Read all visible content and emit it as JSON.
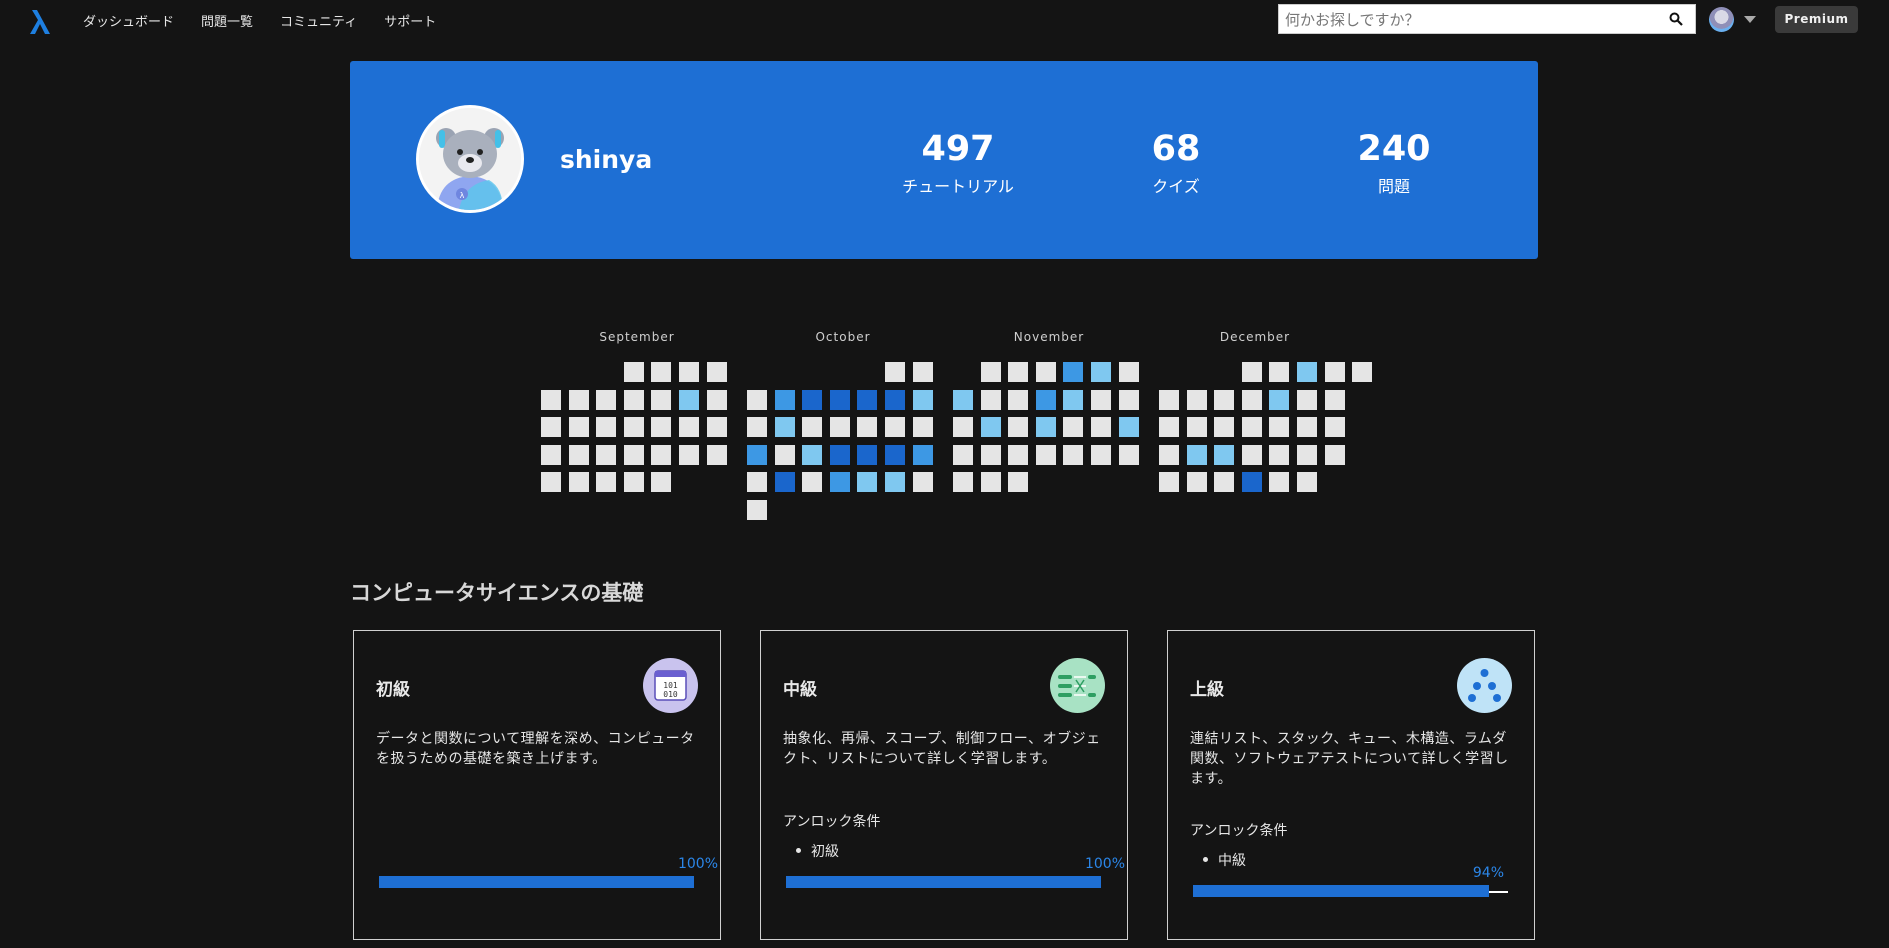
{
  "nav": {
    "links": [
      "ダッシュボード",
      "問題一覧",
      "コミュニティ",
      "サポート"
    ],
    "search_placeholder": "何かお探しですか？",
    "premium_label": "Premium"
  },
  "profile": {
    "username": "shinya",
    "stats": [
      {
        "value": "497",
        "label": "チュートリアル"
      },
      {
        "value": "68",
        "label": "クイズ"
      },
      {
        "value": "240",
        "label": "問題"
      }
    ]
  },
  "calendar": {
    "months": [
      "September",
      "October",
      "November",
      "December"
    ]
  },
  "section": {
    "title": "コンピュータサイエンスの基礎",
    "cards": [
      {
        "title": "初級",
        "icon": "binary-calendar-icon",
        "description": "データと関数について理解を深め、コンピュータを扱うための基礎を築き上げます。",
        "unlock_label": "",
        "unlock_item": "",
        "progress_percent": 100,
        "progress_text": "100%"
      },
      {
        "title": "中級",
        "icon": "flow-list-icon",
        "description": "抽象化、再帰、スコープ、制御フロー、オブジェクト、リストについて詳しく学習します。",
        "unlock_label": "アンロック条件",
        "unlock_item": "初級",
        "progress_percent": 100,
        "progress_text": "100%"
      },
      {
        "title": "上級",
        "icon": "tree-nodes-icon",
        "description": "連結リスト、スタック、キュー、木構造、ラムダ関数、ソフトウェアテストについて詳しく学習します。",
        "unlock_label": "アンロック条件",
        "unlock_item": "中級",
        "progress_percent": 94,
        "progress_text": "94%"
      }
    ]
  },
  "colors": {
    "accent": "#1e6fd4",
    "heat_low": "#7fc8f0",
    "heat_mid": "#3d98e4",
    "heat_high": "#1a66cc",
    "empty_cell": "#e5e5e5"
  }
}
